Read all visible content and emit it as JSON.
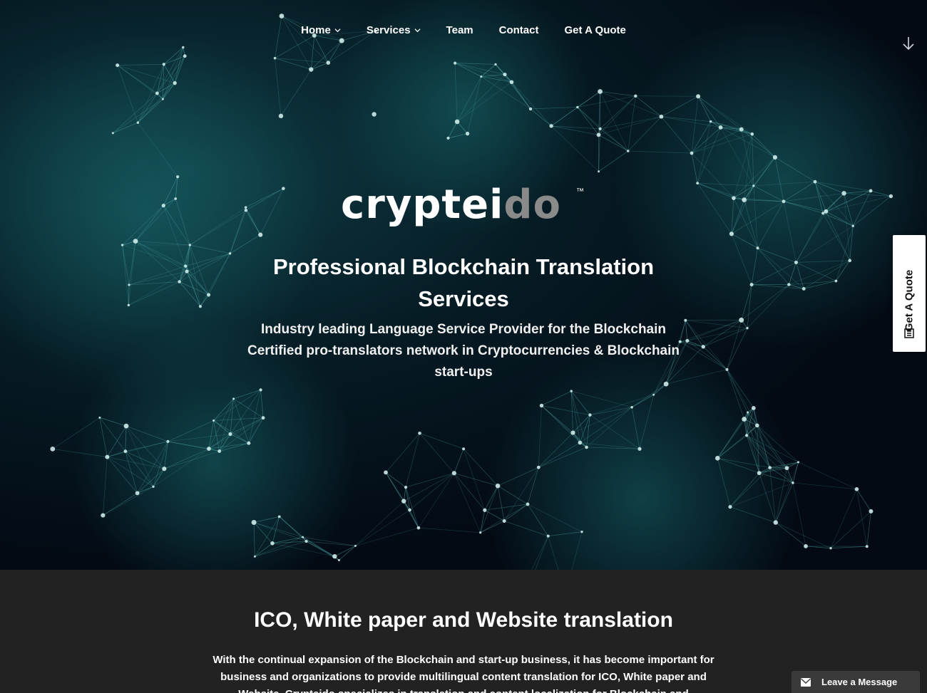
{
  "nav": {
    "items": [
      {
        "label": "Home",
        "has_dropdown": true
      },
      {
        "label": "Services",
        "has_dropdown": true
      },
      {
        "label": "Team",
        "has_dropdown": false
      },
      {
        "label": "Contact",
        "has_dropdown": false
      },
      {
        "label": "Get A Quote",
        "has_dropdown": false
      }
    ],
    "scroll_icon": "arrow-down-icon"
  },
  "hero": {
    "logo": {
      "part1": "crypt",
      "part2": "ei",
      "part3": "do",
      "trademark": "™"
    },
    "title_line1": "Professional Blockchain Translation",
    "title_line2": "Services",
    "subtitle_line1": "Industry leading Language Service Provider for the Blockchain",
    "subtitle_line2": "Certified pro-translators network in Cryptocurrencies & Blockchain",
    "subtitle_line3": "start-ups"
  },
  "side_tab": {
    "label": "Get A Quote",
    "icon": "form-icon"
  },
  "section": {
    "title": "ICO, White paper and Website translation",
    "body": "With the continual expansion of the Blockchain and start-up business, it has become important for business and organizations to provide multilingual content translation for ICO, White paper and Website. Crypteido specializes in translation and content localization for Blockchain and Cryptocurrency projects."
  },
  "chat": {
    "label": "Leave a Message",
    "icon": "envelope-icon"
  },
  "colors": {
    "hero_bg": "#040b14",
    "network_teal": "#5fc4c4",
    "section_bg": "#222222",
    "logo_gray": "#888888"
  }
}
